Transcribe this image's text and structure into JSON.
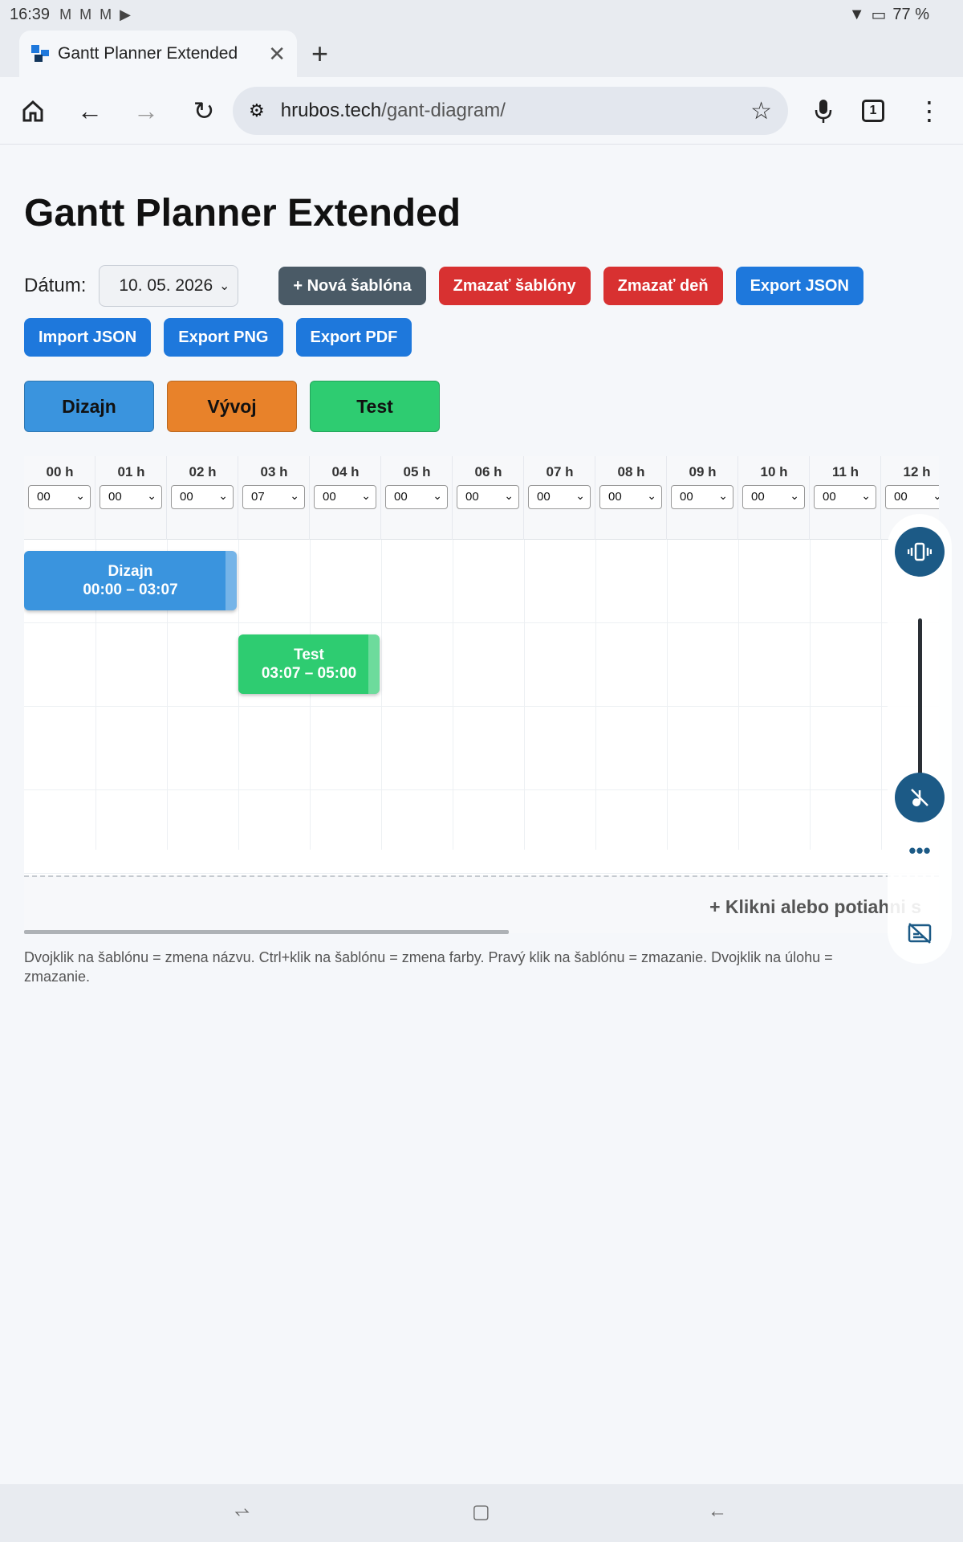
{
  "status_bar": {
    "time": "16:39",
    "notification_icons": [
      "gmail-icon",
      "gmail-icon",
      "gmail-icon",
      "youtube-icon"
    ],
    "battery": "77 %"
  },
  "browser": {
    "tab_title": "Gantt Planner Extended",
    "url_host": "hrubos.tech",
    "url_path": "/gant-diagram/",
    "tab_count": "1"
  },
  "page": {
    "title": "Gantt Planner Extended",
    "date_label": "Dátum:",
    "date_value": "10. 05. 2026",
    "buttons": {
      "new_template": "+ Nová šablóna",
      "delete_templates": "Zmazať šablóny",
      "delete_day": "Zmazať deň",
      "export_json": "Export JSON",
      "import_json": "Import JSON",
      "export_png": "Export PNG",
      "export_pdf": "Export PDF"
    },
    "templates": [
      {
        "label": "Dizajn",
        "color": "#3a94de"
      },
      {
        "label": "Vývoj",
        "color": "#e8822a"
      },
      {
        "label": "Test",
        "color": "#2ecc71"
      }
    ],
    "hours": [
      {
        "label": "00 h",
        "minute": "00"
      },
      {
        "label": "01 h",
        "minute": "00"
      },
      {
        "label": "02 h",
        "minute": "00"
      },
      {
        "label": "03 h",
        "minute": "07"
      },
      {
        "label": "04 h",
        "minute": "00"
      },
      {
        "label": "05 h",
        "minute": "00"
      },
      {
        "label": "06 h",
        "minute": "00"
      },
      {
        "label": "07 h",
        "minute": "00"
      },
      {
        "label": "08 h",
        "minute": "00"
      },
      {
        "label": "09 h",
        "minute": "00"
      },
      {
        "label": "10 h",
        "minute": "00"
      },
      {
        "label": "11 h",
        "minute": "00"
      },
      {
        "label": "12 h",
        "minute": "00"
      }
    ],
    "tasks": [
      {
        "name": "Dizajn",
        "time": "00:00 – 03:07",
        "color": "#3a94de",
        "row": 0,
        "start_hour": 0,
        "end_hour": 3.0
      },
      {
        "name": "Test",
        "time": "03:07 – 05:00",
        "color": "#2ecc71",
        "row": 1,
        "start_hour": 3.0,
        "end_hour": 5.0
      }
    ],
    "add_hint": "+ Klikni alebo potiahni s",
    "help_text": "Dvojklik na šablónu = zmena názvu. Ctrl+klik na šablónu = zmena farby. Pravý klik na šablónu = zmazanie. Dvojklik na úlohu = zmazanie."
  },
  "colors": {
    "gray_button": "#4a5a66",
    "red_button": "#d83131",
    "blue_button": "#1e78dc",
    "overlay_accent": "#1c5a86"
  }
}
